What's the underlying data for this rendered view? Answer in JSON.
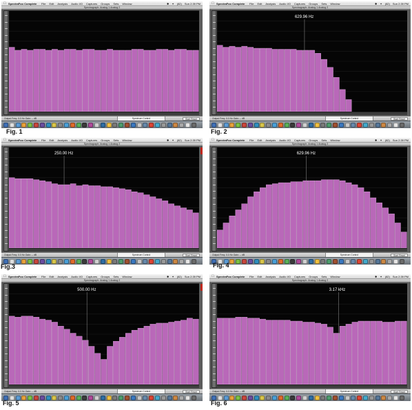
{
  "app_menu": {
    "app_name": "SpectraFoo Complete",
    "menus": [
      "File",
      "Edit",
      "Analysis",
      "Audio I/O",
      "Captures",
      "Groups",
      "Sets",
      "Window"
    ],
    "status_items": [
      "✱",
      "✦",
      "(82)",
      "Sun 2:39 PM"
    ]
  },
  "window_title": "Spectragraph: Analog 1 Analog 2",
  "control_bar": {
    "readout": "Output Freq: 0.0 Hz  Gain: -- dB",
    "spectrum_control": "Spectrum Control",
    "dialog_button": "Start Reset"
  },
  "bar_color": "#b968b9",
  "bar_edge_color": "#dfb1df",
  "plot_background": "#050505",
  "figures": [
    {
      "caption": "Fig. 1",
      "freq_label": "",
      "label_position": 0.0,
      "levels": [
        0.64,
        0.61,
        0.62,
        0.61,
        0.62,
        0.62,
        0.61,
        0.62,
        0.61,
        0.62,
        0.62,
        0.61,
        0.62,
        0.62,
        0.61,
        0.61,
        0.62,
        0.61,
        0.61,
        0.61,
        0.62,
        0.62,
        0.61,
        0.61,
        0.62,
        0.62,
        0.61,
        0.62,
        0.62,
        0.61,
        0.61
      ]
    },
    {
      "caption": "Fig. 2",
      "freq_label": "629.96 Hz",
      "label_position": 0.46,
      "levels": [
        0.66,
        0.64,
        0.65,
        0.64,
        0.65,
        0.64,
        0.63,
        0.63,
        0.63,
        0.62,
        0.62,
        0.62,
        0.62,
        0.61,
        0.61,
        0.61,
        0.58,
        0.52,
        0.44,
        0.34,
        0.22,
        0.12,
        0.0,
        0.0,
        0.0,
        0.0,
        0.0,
        0.0,
        0.0,
        0.0,
        0.0
      ]
    },
    {
      "caption": "Fig.3",
      "freq_label": "250.00 Hz",
      "label_position": 0.29,
      "levels": [
        0.7,
        0.69,
        0.69,
        0.69,
        0.68,
        0.67,
        0.66,
        0.64,
        0.63,
        0.63,
        0.64,
        0.62,
        0.63,
        0.62,
        0.62,
        0.61,
        0.61,
        0.6,
        0.59,
        0.58,
        0.56,
        0.55,
        0.53,
        0.51,
        0.49,
        0.47,
        0.44,
        0.42,
        0.4,
        0.38,
        0.35
      ]
    },
    {
      "caption": "Fig. 4",
      "freq_label": "629.96 Hz",
      "label_position": 0.47,
      "levels": [
        0.18,
        0.25,
        0.32,
        0.38,
        0.44,
        0.51,
        0.56,
        0.6,
        0.63,
        0.64,
        0.65,
        0.65,
        0.66,
        0.66,
        0.67,
        0.67,
        0.67,
        0.68,
        0.68,
        0.68,
        0.67,
        0.65,
        0.63,
        0.6,
        0.56,
        0.5,
        0.45,
        0.4,
        0.34,
        0.25,
        0.16
      ]
    },
    {
      "caption": "Fig. 5",
      "freq_label": "500.00 Hz",
      "label_position": 0.41,
      "levels": [
        0.68,
        0.67,
        0.68,
        0.68,
        0.67,
        0.65,
        0.64,
        0.62,
        0.58,
        0.55,
        0.51,
        0.48,
        0.44,
        0.38,
        0.31,
        0.25,
        0.38,
        0.43,
        0.47,
        0.51,
        0.54,
        0.56,
        0.58,
        0.6,
        0.61,
        0.61,
        0.62,
        0.63,
        0.64,
        0.66,
        0.65
      ]
    },
    {
      "caption": "Fig. 6",
      "freq_label": "3.17 kHz",
      "label_position": 0.64,
      "levels": [
        0.66,
        0.66,
        0.66,
        0.67,
        0.67,
        0.66,
        0.66,
        0.65,
        0.64,
        0.64,
        0.64,
        0.64,
        0.63,
        0.63,
        0.62,
        0.62,
        0.61,
        0.6,
        0.57,
        0.51,
        0.58,
        0.6,
        0.62,
        0.63,
        0.63,
        0.63,
        0.63,
        0.62,
        0.62,
        0.63,
        0.63
      ]
    }
  ]
}
